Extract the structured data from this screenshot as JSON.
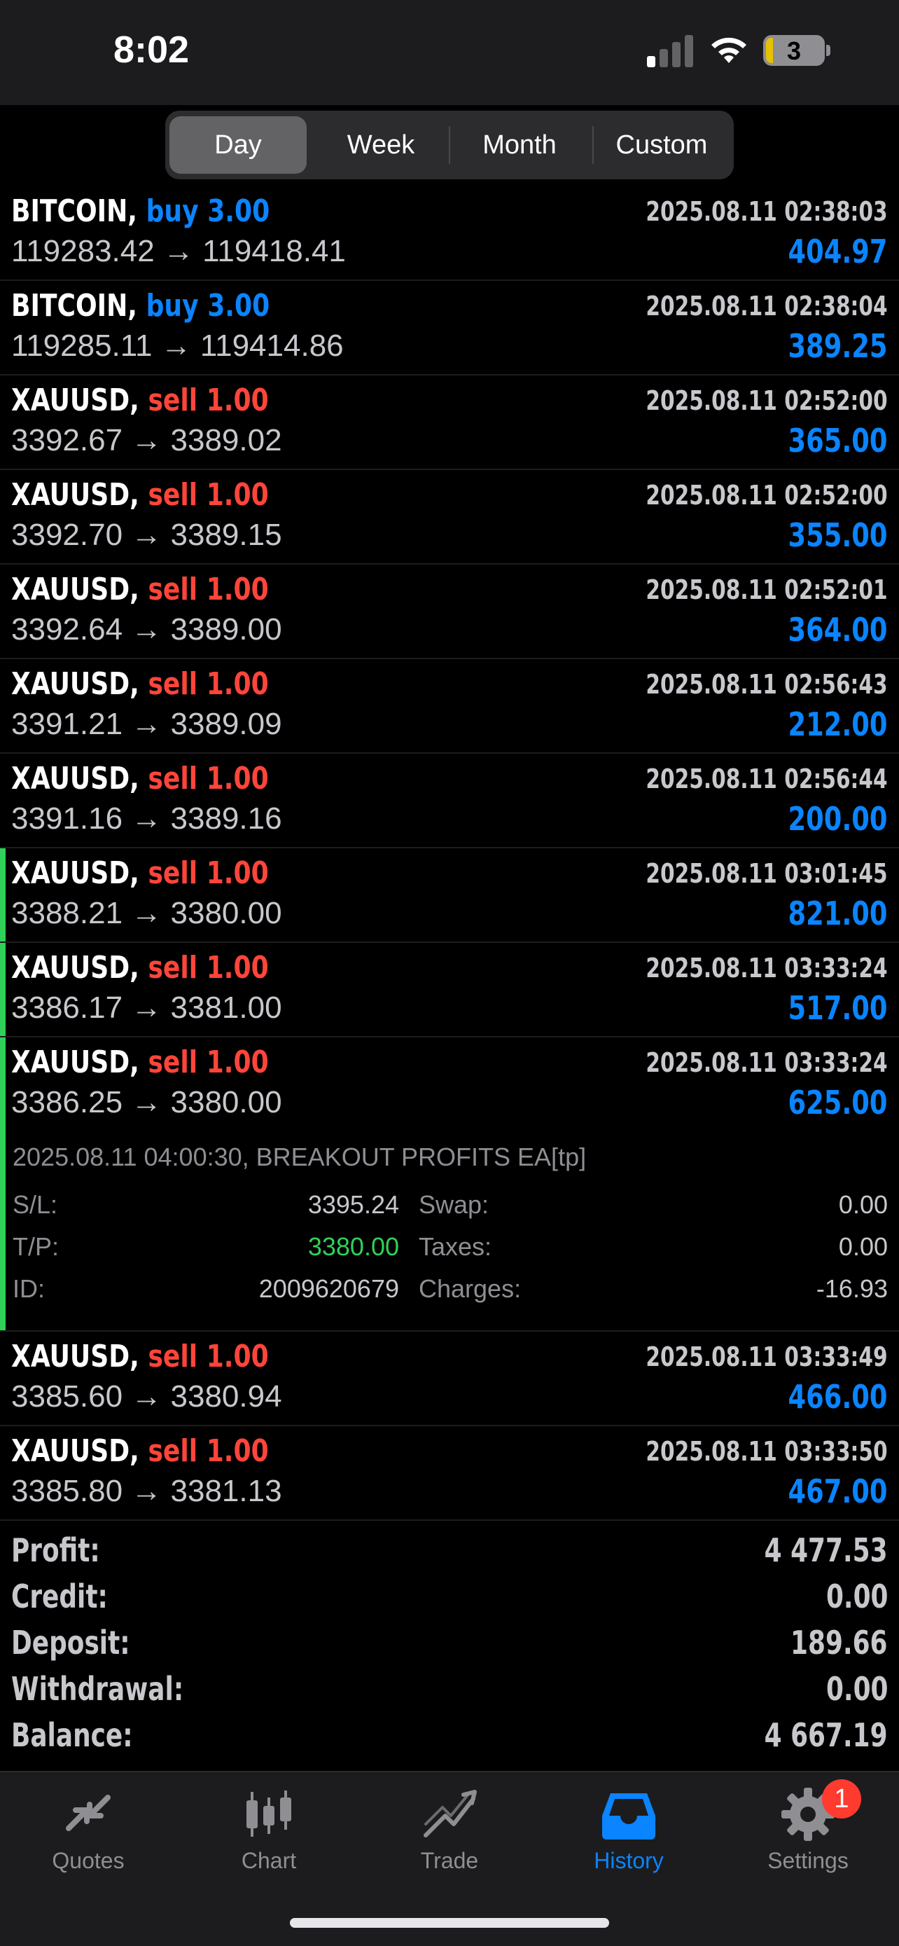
{
  "status": {
    "time": "8:02",
    "battery": "3"
  },
  "periods": [
    "Day",
    "Week",
    "Month",
    "Custom"
  ],
  "deals": [
    {
      "symbol": "BITCOIN,",
      "side": "buy",
      "volume": "3.00",
      "time": "2025.08.11 02:38:03",
      "prices": "119283.42 → 119418.41",
      "profit": "404.97"
    },
    {
      "symbol": "BITCOIN,",
      "side": "buy",
      "volume": "3.00",
      "time": "2025.08.11 02:38:04",
      "prices": "119285.11 → 119414.86",
      "profit": "389.25"
    },
    {
      "symbol": "XAUUSD,",
      "side": "sell",
      "volume": "1.00",
      "time": "2025.08.11 02:52:00",
      "prices": "3392.67 → 3389.02",
      "profit": "365.00"
    },
    {
      "symbol": "XAUUSD,",
      "side": "sell",
      "volume": "1.00",
      "time": "2025.08.11 02:52:00",
      "prices": "3392.70 → 3389.15",
      "profit": "355.00"
    },
    {
      "symbol": "XAUUSD,",
      "side": "sell",
      "volume": "1.00",
      "time": "2025.08.11 02:52:01",
      "prices": "3392.64 → 3389.00",
      "profit": "364.00"
    },
    {
      "symbol": "XAUUSD,",
      "side": "sell",
      "volume": "1.00",
      "time": "2025.08.11 02:56:43",
      "prices": "3391.21 → 3389.09",
      "profit": "212.00"
    },
    {
      "symbol": "XAUUSD,",
      "side": "sell",
      "volume": "1.00",
      "time": "2025.08.11 02:56:44",
      "prices": "3391.16 → 3389.16",
      "profit": "200.00"
    },
    {
      "symbol": "XAUUSD,",
      "side": "sell",
      "volume": "1.00",
      "time": "2025.08.11 03:01:45",
      "prices": "3388.21 → 3380.00",
      "profit": "821.00"
    },
    {
      "symbol": "XAUUSD,",
      "side": "sell",
      "volume": "1.00",
      "time": "2025.08.11 03:33:24",
      "prices": "3386.17 → 3381.00",
      "profit": "517.00"
    },
    {
      "symbol": "XAUUSD,",
      "side": "sell",
      "volume": "1.00",
      "time": "2025.08.11 03:33:24",
      "prices": "3386.25 → 3380.00",
      "profit": "625.00"
    },
    {
      "symbol": "XAUUSD,",
      "side": "sell",
      "volume": "1.00",
      "time": "2025.08.11 03:33:49",
      "prices": "3385.60 → 3380.94",
      "profit": "466.00"
    },
    {
      "symbol": "XAUUSD,",
      "side": "sell",
      "volume": "1.00",
      "time": "2025.08.11 03:33:50",
      "prices": "3385.80 → 3381.13",
      "profit": "467.00"
    }
  ],
  "expanded": {
    "header": "2025.08.11 04:00:30, BREAKOUT PROFITS EA[tp]",
    "sl_label": "S/L:",
    "sl": "3395.24",
    "tp_label": "T/P:",
    "tp": "3380.00",
    "id_label": "ID:",
    "id": "2009620679",
    "swap_label": "Swap:",
    "swap": "0.00",
    "taxes_label": "Taxes:",
    "taxes": "0.00",
    "charges_label": "Charges:",
    "charges": "-16.93"
  },
  "summary": [
    {
      "label": "Profit:",
      "value": "4 477.53"
    },
    {
      "label": "Credit:",
      "value": "0.00"
    },
    {
      "label": "Deposit:",
      "value": "189.66"
    },
    {
      "label": "Withdrawal:",
      "value": "0.00"
    },
    {
      "label": "Balance:",
      "value": "4 667.19"
    }
  ],
  "tabs": [
    {
      "label": "Quotes",
      "icon": "quotes-icon"
    },
    {
      "label": "Chart",
      "icon": "chart-icon"
    },
    {
      "label": "Trade",
      "icon": "trade-icon"
    },
    {
      "label": "History",
      "icon": "history-icon"
    },
    {
      "label": "Settings",
      "icon": "gear-icon"
    }
  ],
  "settings_badge": "1",
  "colors": {
    "buy": "#0a84ff",
    "sell": "#ff453a",
    "profit": "#0a84ff",
    "accent": "#0a84ff",
    "highlight_bar": "#30d158"
  }
}
